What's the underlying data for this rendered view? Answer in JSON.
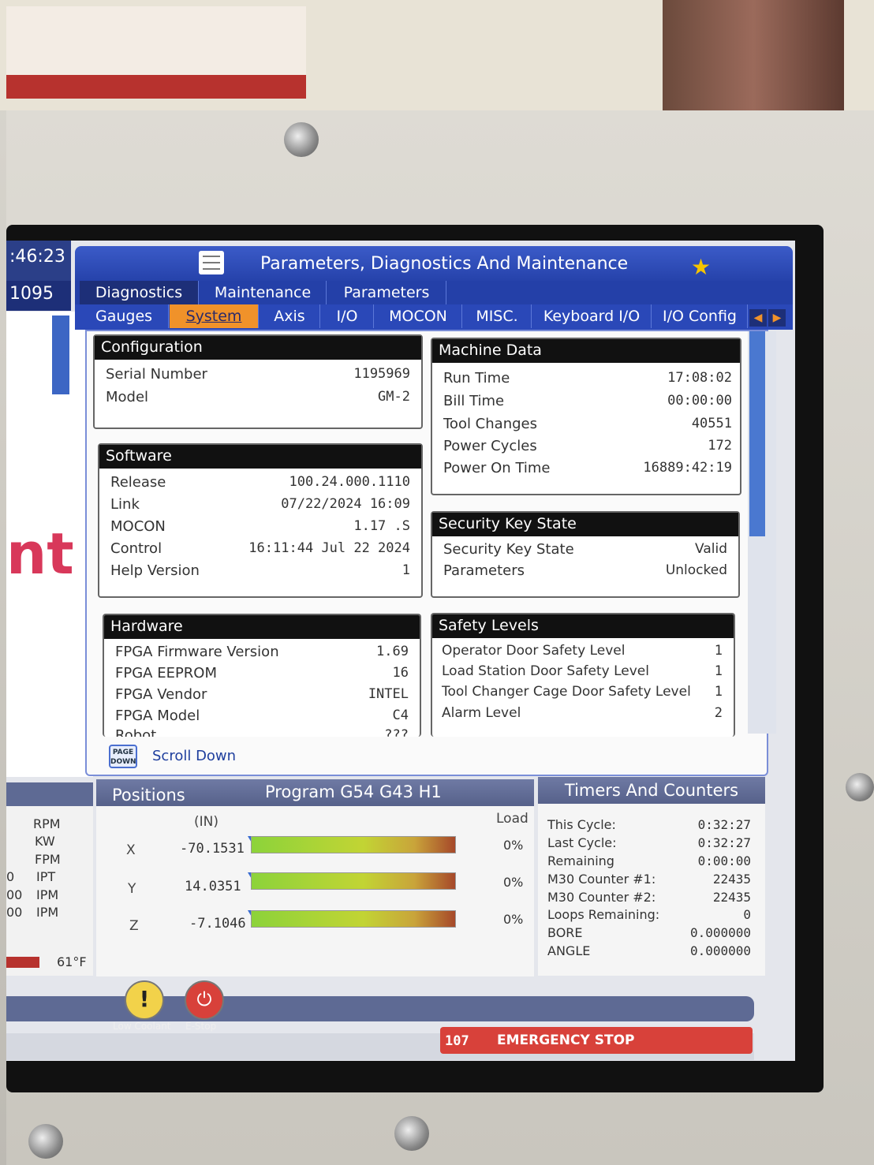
{
  "left_strip": {
    "time_fragment": ":46:23",
    "number_fragment": "1095",
    "big_text_fragment": "nt",
    "temp": "61°F",
    "units": [
      "RPM",
      "KW",
      "FPM",
      "IPT",
      "IPM",
      "IPM"
    ],
    "unit_prefixes": [
      "",
      "",
      "",
      "0",
      "00",
      "00"
    ]
  },
  "header": {
    "title": "Parameters, Diagnostics And Maintenance"
  },
  "tabs_top": [
    "Diagnostics",
    "Maintenance",
    "Parameters"
  ],
  "tabs_sub": [
    "Gauges",
    "System",
    "Axis",
    "I/O",
    "MOCON",
    "MISC.",
    "Keyboard I/O",
    "I/O Config"
  ],
  "configuration": {
    "title": "Configuration",
    "rows": [
      {
        "label": "Serial Number",
        "value": "1195969"
      },
      {
        "label": "Model",
        "value": "GM-2"
      }
    ]
  },
  "software": {
    "title": "Software",
    "rows": [
      {
        "label": "Release",
        "value": "100.24.000.1110"
      },
      {
        "label": "Link",
        "value": "07/22/2024 16:09"
      },
      {
        "label": "MOCON",
        "value": "1.17  .S"
      },
      {
        "label": "Control",
        "value": "16:11:44  Jul 22 2024"
      },
      {
        "label": "Help Version",
        "value": "1"
      }
    ]
  },
  "hardware": {
    "title": "Hardware",
    "rows": [
      {
        "label": "FPGA Firmware Version",
        "value": "1.69"
      },
      {
        "label": "FPGA EEPROM",
        "value": "16"
      },
      {
        "label": "FPGA Vendor",
        "value": "INTEL"
      },
      {
        "label": "FPGA Model",
        "value": "C4"
      },
      {
        "label": "Robot",
        "value": "???"
      }
    ]
  },
  "machine_data": {
    "title": "Machine Data",
    "rows": [
      {
        "label": "Run Time",
        "value": "17:08:02"
      },
      {
        "label": "Bill Time",
        "value": "00:00:00"
      },
      {
        "label": "Tool Changes",
        "value": "40551"
      },
      {
        "label": "Power Cycles",
        "value": "172"
      },
      {
        "label": "Power On Time",
        "value": "16889:42:19"
      }
    ]
  },
  "security_key": {
    "title": "Security Key State",
    "rows": [
      {
        "label": "Security Key State",
        "value": "Valid"
      },
      {
        "label": "Parameters",
        "value": "Unlocked"
      }
    ]
  },
  "safety_levels": {
    "title": "Safety Levels",
    "rows": [
      {
        "label": "Operator Door Safety Level",
        "value": "1"
      },
      {
        "label": "Load Station Door Safety Level",
        "value": "1"
      },
      {
        "label": "Tool Changer Cage Door Safety Level",
        "value": "1"
      },
      {
        "label": "Alarm Level",
        "value": "2"
      }
    ]
  },
  "scroll": {
    "page_down_line1": "PAGE",
    "page_down_line2": "DOWN",
    "label": "Scroll Down"
  },
  "positions": {
    "title": "Positions",
    "program": "Program G54 G43 H1",
    "unit": "(IN)",
    "load_label": "Load",
    "axes": [
      {
        "axis": "X",
        "value": "-70.1531",
        "load": "0%",
        "load_fraction": 0
      },
      {
        "axis": "Y",
        "value": "14.0351",
        "load": "0%",
        "load_fraction": 0
      },
      {
        "axis": "Z",
        "value": "-7.1046",
        "load": "0%",
        "load_fraction": 0
      }
    ]
  },
  "timers": {
    "title": "Timers And Counters",
    "rows": [
      {
        "label": "This Cycle:",
        "value": "0:32:27"
      },
      {
        "label": "Last Cycle:",
        "value": "0:32:27"
      },
      {
        "label": "Remaining",
        "value": "0:00:00"
      },
      {
        "label": "M30 Counter #1:",
        "value": "22435"
      },
      {
        "label": "M30 Counter #2:",
        "value": "22435"
      },
      {
        "label": "Loops Remaining:",
        "value": "0"
      },
      {
        "label": "BORE",
        "value": "0.000000"
      },
      {
        "label": "ANGLE",
        "value": "0.000000"
      }
    ]
  },
  "alerts": {
    "low_coolant": "Low Coolant",
    "estop": "E-Stop"
  },
  "alarm": {
    "code": "107",
    "text": "EMERGENCY STOP"
  },
  "colors": {
    "header_blue": "#2440a8",
    "active_tab_orange": "#f0922a",
    "alarm_red": "#d8413a"
  }
}
